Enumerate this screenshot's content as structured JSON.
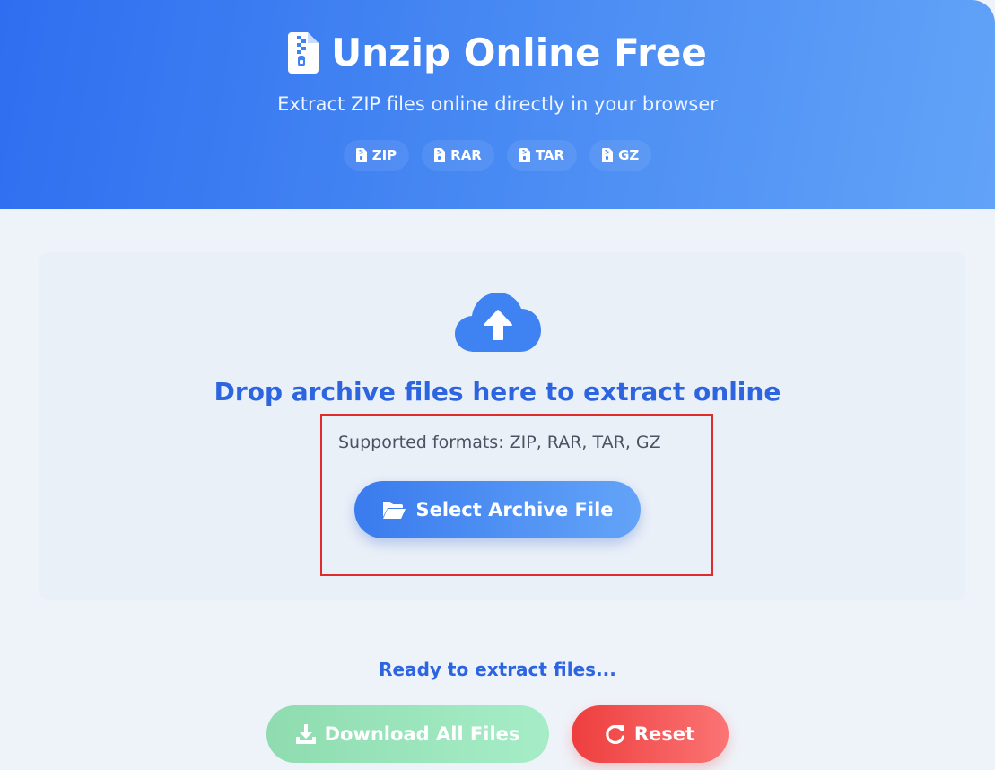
{
  "header": {
    "title": "Unzip Online Free",
    "subtitle": "Extract ZIP files online directly in your browser",
    "title_icon": "file-zipper-icon",
    "formats": [
      {
        "label": "ZIP",
        "icon": "file-zipper-icon"
      },
      {
        "label": "RAR",
        "icon": "file-zipper-icon"
      },
      {
        "label": "TAR",
        "icon": "file-zipper-icon"
      },
      {
        "label": "GZ",
        "icon": "file-zipper-icon"
      }
    ]
  },
  "dropzone": {
    "icon": "cloud-upload-icon",
    "heading": "Drop archive files here to extract online",
    "supported_text": "Supported formats: ZIP, RAR, TAR, GZ",
    "select_button": {
      "label": "Select Archive File",
      "icon": "folder-open-icon"
    }
  },
  "status": {
    "text": "Ready to extract files..."
  },
  "actions": {
    "download": {
      "label": "Download All Files",
      "icon": "download-icon",
      "enabled": false
    },
    "reset": {
      "label": "Reset",
      "icon": "redo-icon",
      "enabled": true
    }
  },
  "colors": {
    "primary": "#2d64e0",
    "header_gradient_start": "#2f6ef0",
    "header_gradient_end": "#62a3f8",
    "download_disabled": "#a6edc7",
    "reset": "#ee3e3e",
    "highlight_border": "#e02b2b"
  }
}
